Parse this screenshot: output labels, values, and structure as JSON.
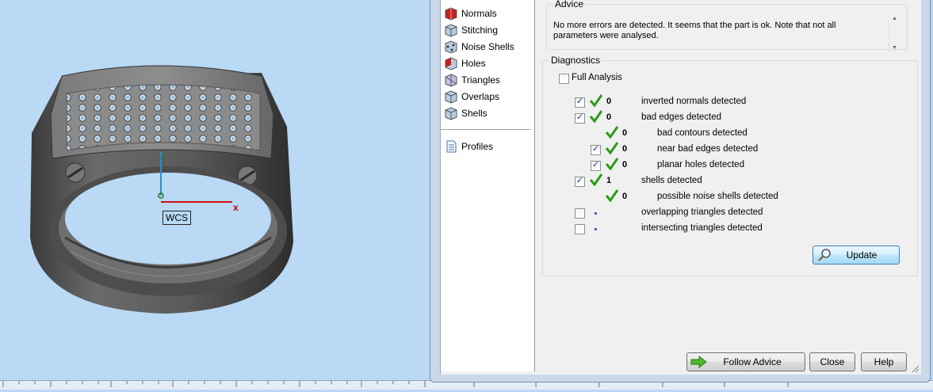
{
  "viewport": {
    "axis_label": "WCS",
    "x_axis": "x"
  },
  "sidebar": {
    "items": [
      {
        "label": "Normals",
        "icon": "normals-icon"
      },
      {
        "label": "Stitching",
        "icon": "stitching-icon"
      },
      {
        "label": "Noise Shells",
        "icon": "noise-shells-icon"
      },
      {
        "label": "Holes",
        "icon": "holes-icon"
      },
      {
        "label": "Triangles",
        "icon": "triangles-icon"
      },
      {
        "label": "Overlaps",
        "icon": "overlaps-icon"
      },
      {
        "label": "Shells",
        "icon": "shells-icon"
      }
    ],
    "profiles": "Profiles"
  },
  "advice": {
    "title": "Advice",
    "text": "No more errors are detected. It seems that the part is ok. Note that not all parameters were analysed."
  },
  "diagnostics": {
    "title": "Diagnostics",
    "full_analysis": "Full Analysis",
    "rows": [
      {
        "count": "0",
        "label": "inverted normals detected"
      },
      {
        "count": "0",
        "label": "bad edges detected"
      },
      {
        "count": "0",
        "label": "bad contours detected"
      },
      {
        "count": "0",
        "label": "near bad edges detected"
      },
      {
        "count": "0",
        "label": "planar holes detected"
      },
      {
        "count": "1",
        "label": "shells detected"
      },
      {
        "count": "0",
        "label": "possible noise shells detected"
      },
      {
        "count": "",
        "label": "overlapping triangles detected"
      },
      {
        "count": "",
        "label": "intersecting triangles detected"
      }
    ],
    "update": "Update"
  },
  "footer": {
    "follow_advice": "Follow Advice",
    "close": "Close",
    "help": "Help"
  },
  "colors": {
    "tick": "#2e9a1c",
    "accent": "#3c7fb1"
  }
}
